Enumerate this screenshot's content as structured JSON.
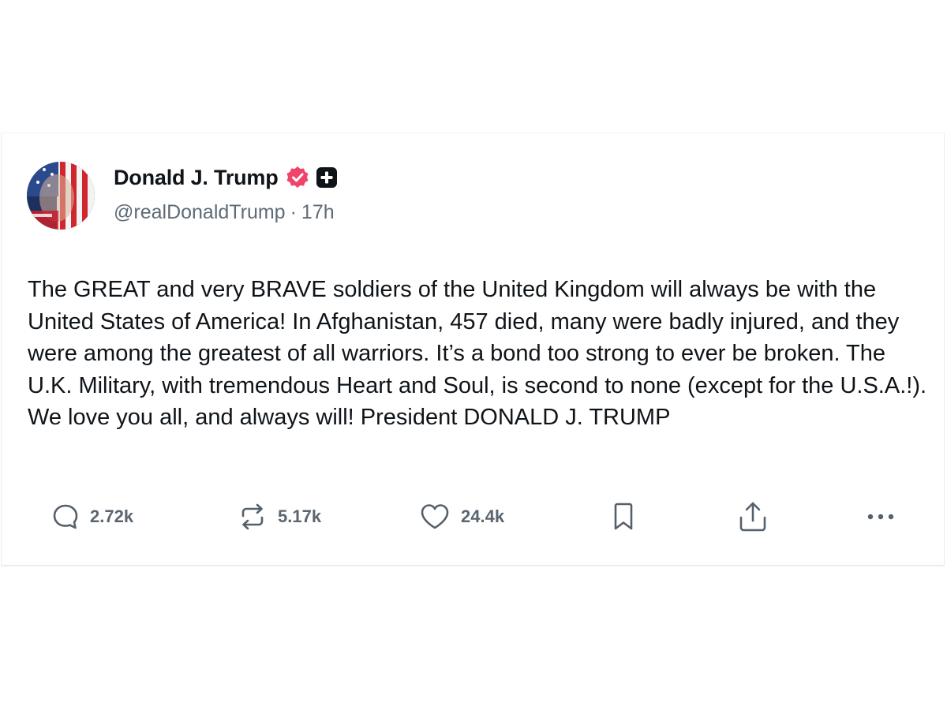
{
  "post": {
    "author": {
      "display_name": "Donald J. Trump",
      "handle": "@realDonaldTrump",
      "separator": "·",
      "time_ago": "17h",
      "verified_badge_icon": "verified-check-icon",
      "verified_badge_color": "#f0446a",
      "plus_badge_icon": "plus-badge-icon"
    },
    "text": "The GREAT and very BRAVE soldiers of the United Kingdom will always be with the United States of America! In Afghanistan, 457 died, many were badly injured, and they were among the greatest of all warriors. It’s a bond too strong to ever be broken. The U.K. Military, with tremendous Heart and Soul, is second to none (except for the U.S.A.!). We love you all, and always will! President DONALD J. TRUMP",
    "actions": {
      "reply": {
        "icon": "reply-bubble-icon",
        "count": "2.72k"
      },
      "repost": {
        "icon": "repost-arrows-icon",
        "count": "5.17k"
      },
      "like": {
        "icon": "heart-icon",
        "count": "24.4k"
      },
      "bookmark": {
        "icon": "bookmark-icon"
      },
      "share": {
        "icon": "share-upload-icon"
      },
      "more": {
        "icon": "more-dots-icon"
      }
    }
  }
}
